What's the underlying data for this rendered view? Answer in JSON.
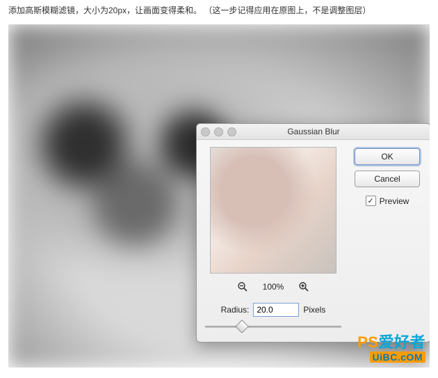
{
  "caption": "添加高斯模糊滤镜，大小为20px，让画面变得柔和。 （这一步记得应用在原图上，不是调整图层）",
  "dialog": {
    "title": "Gaussian Blur",
    "ok": "OK",
    "cancel": "Cancel",
    "preview_label": "Preview",
    "preview_checked": "✓",
    "zoom_percent": "100%",
    "radius_label": "Radius:",
    "radius_value": "20.0",
    "radius_unit": "Pixels"
  },
  "watermark": {
    "line1a": "PS",
    "line1b": "爱好者",
    "line2": "UiBC.cOM"
  }
}
